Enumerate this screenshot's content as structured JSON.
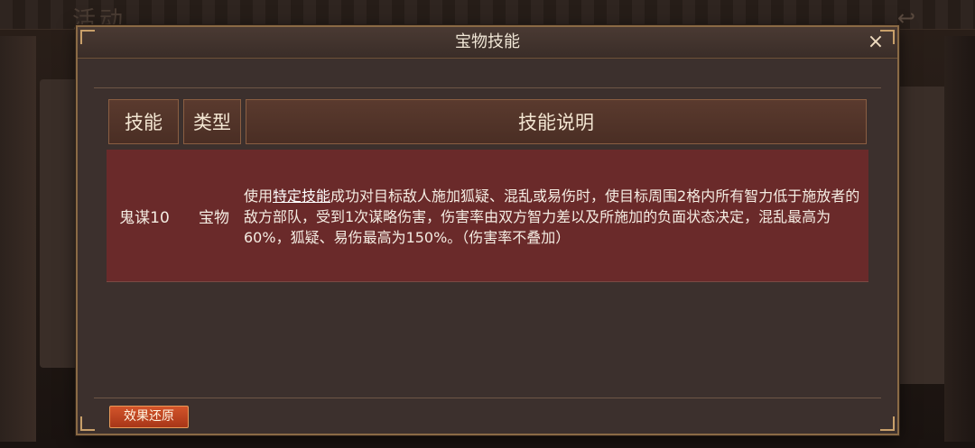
{
  "background": {
    "title": "活动"
  },
  "dialog": {
    "title": "宝物技能",
    "close_label": "×"
  },
  "table": {
    "headers": [
      "技能",
      "类型",
      "技能说明"
    ],
    "rows": [
      {
        "skill": "鬼谋10",
        "type": "宝物",
        "desc_prefix": "使用",
        "desc_link": "特定技能",
        "desc_suffix": "成功对目标敌人施加狐疑、混乱或易伤时，使目标周围2格内所有智力低于施放者的敌方部队，受到1次谋略伤害，伤害率由双方智力差以及所施加的负面状态决定，混乱最高为60%，狐疑、易伤最高为150%。（伤害率不叠加）"
      }
    ]
  },
  "footer": {
    "restore_label": "效果还原"
  },
  "colors": {
    "row_bg": "#6a2a2a",
    "header_bg": "#5a3a2e",
    "accent_button": "#c4461f",
    "frame_gold": "#8a6a45"
  }
}
